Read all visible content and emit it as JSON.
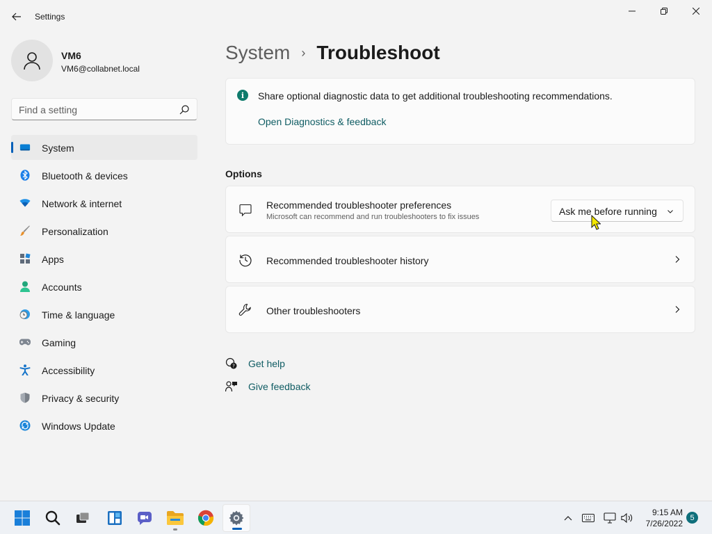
{
  "window": {
    "title": "Settings"
  },
  "user": {
    "name": "VM6",
    "email": "VM6@collabnet.local"
  },
  "search": {
    "placeholder": "Find a setting"
  },
  "sidebar": {
    "items": [
      {
        "label": "System",
        "icon": "system-icon",
        "active": true
      },
      {
        "label": "Bluetooth & devices",
        "icon": "bluetooth-icon"
      },
      {
        "label": "Network & internet",
        "icon": "wifi-icon"
      },
      {
        "label": "Personalization",
        "icon": "brush-icon"
      },
      {
        "label": "Apps",
        "icon": "apps-icon"
      },
      {
        "label": "Accounts",
        "icon": "accounts-icon"
      },
      {
        "label": "Time & language",
        "icon": "clock-globe-icon"
      },
      {
        "label": "Gaming",
        "icon": "gamepad-icon"
      },
      {
        "label": "Accessibility",
        "icon": "accessibility-icon"
      },
      {
        "label": "Privacy & security",
        "icon": "shield-icon"
      },
      {
        "label": "Windows Update",
        "icon": "update-icon"
      }
    ]
  },
  "breadcrumb": {
    "parent": "System",
    "separator": "›",
    "current": "Troubleshoot"
  },
  "info_card": {
    "text": "Share optional diagnostic data to get additional troubleshooting recommendations.",
    "link": "Open Diagnostics & feedback"
  },
  "options": {
    "section_title": "Options",
    "rows": [
      {
        "title": "Recommended troubleshooter preferences",
        "subtitle": "Microsoft can recommend and run troubleshooters to fix issues",
        "dropdown_value": "Ask me before running"
      },
      {
        "title": "Recommended troubleshooter history"
      },
      {
        "title": "Other troubleshooters"
      }
    ]
  },
  "help_links": {
    "get_help": "Get help",
    "give_feedback": "Give feedback"
  },
  "taskbar": {
    "apps": [
      "start-icon",
      "search-icon",
      "task-view-icon",
      "widgets-icon",
      "chat-icon",
      "file-explorer-icon",
      "chrome-icon",
      "settings-icon"
    ],
    "clock_time": "9:15 AM",
    "clock_date": "7/26/2022",
    "notification_count": "5"
  },
  "colors": {
    "accent": "#005fb8",
    "link": "#0f5c63",
    "info": "#0f7b6c",
    "background": "#f3f3f3",
    "card": "#fbfbfb"
  }
}
